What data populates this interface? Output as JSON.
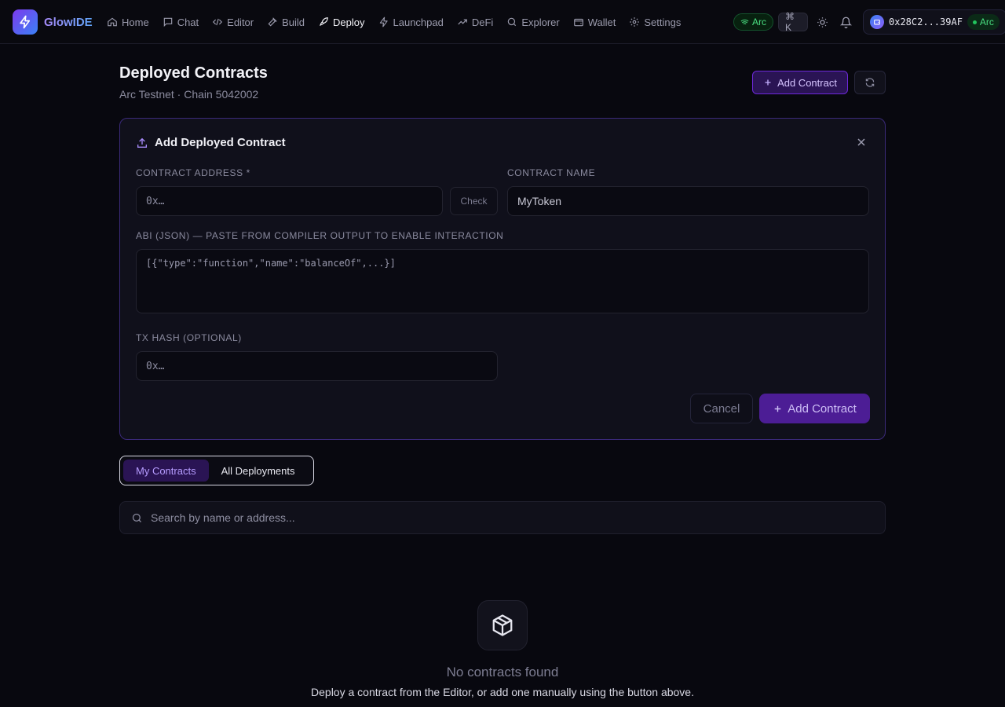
{
  "app": {
    "name": "GlowIDE"
  },
  "nav": [
    {
      "label": "Home",
      "icon": "home-icon"
    },
    {
      "label": "Chat",
      "icon": "chat-icon"
    },
    {
      "label": "Editor",
      "icon": "code-icon"
    },
    {
      "label": "Build",
      "icon": "hammer-icon"
    },
    {
      "label": "Deploy",
      "icon": "rocket-icon",
      "active": true
    },
    {
      "label": "Launchpad",
      "icon": "bolt-icon"
    },
    {
      "label": "DeFi",
      "icon": "trending-icon"
    },
    {
      "label": "Explorer",
      "icon": "search-icon"
    },
    {
      "label": "Wallet",
      "icon": "wallet-icon"
    },
    {
      "label": "Settings",
      "icon": "gear-icon"
    }
  ],
  "topbar": {
    "network_label": "Arc",
    "shortcut_label": "⌘ K",
    "wallet_address": "0x28C2...39AF",
    "wallet_network": "Arc"
  },
  "header": {
    "title": "Deployed Contracts",
    "subtitle": "Arc Testnet · Chain 5042002",
    "add_button": "Add Contract"
  },
  "form": {
    "title": "Add Deployed Contract",
    "address_label": "Contract Address *",
    "address_placeholder": "0x…",
    "check_button": "Check",
    "name_label": "Contract Name",
    "name_value": "MyToken",
    "abi_label": "ABI (JSON) — paste from compiler output to enable interaction",
    "abi_placeholder": "[{\"type\":\"function\",\"name\":\"balanceOf\",...}]",
    "txhash_label": "TX Hash (optional)",
    "txhash_placeholder": "0x…",
    "cancel_button": "Cancel",
    "submit_button": "Add Contract"
  },
  "tabs": [
    {
      "label": "My Contracts",
      "active": true
    },
    {
      "label": "All Deployments",
      "active": false
    }
  ],
  "search": {
    "placeholder": "Search by name or address..."
  },
  "empty": {
    "title": "No contracts found",
    "text": "Deploy a contract from the Editor, or add one manually using the button above."
  },
  "colors": {
    "accent": "#7c3aed",
    "accent_dark": "#4c1d95",
    "success": "#4ade80",
    "background": "#08080f"
  }
}
